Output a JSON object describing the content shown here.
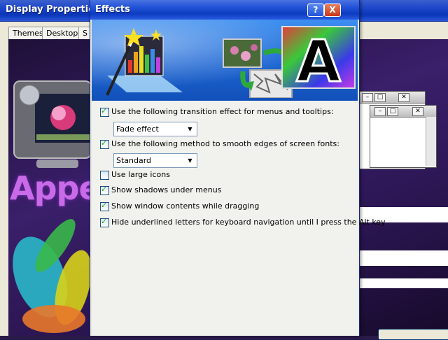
{
  "background_window": {
    "title": "Display Properties",
    "tabs": [
      "Themes",
      "Desktop",
      "S"
    ],
    "preview_text": "Appeara"
  },
  "dialog": {
    "title": "Effects",
    "help_label": "?",
    "close_label": "X",
    "banner_letter": "A",
    "options": [
      {
        "label": "Use the following transition effect for menus and tooltips:",
        "checked": true
      },
      {
        "label": "Use the following method to smooth edges of screen fonts:",
        "checked": true
      },
      {
        "label": "Use large icons",
        "checked": false
      },
      {
        "label": "Show shadows under menus",
        "checked": true
      },
      {
        "label": "Show window contents while dragging",
        "checked": true
      },
      {
        "label": "Hide underlined letters for keyboard navigation until I press the Alt key",
        "checked": true
      }
    ],
    "transition_select": {
      "value": "Fade effect"
    },
    "smoothing_select": {
      "value": "Standard"
    }
  },
  "colors": {
    "xp_title_blue": "#0c3cc0",
    "dialog_face": "#ece9d8",
    "checkbox_mark": "#21a121"
  }
}
